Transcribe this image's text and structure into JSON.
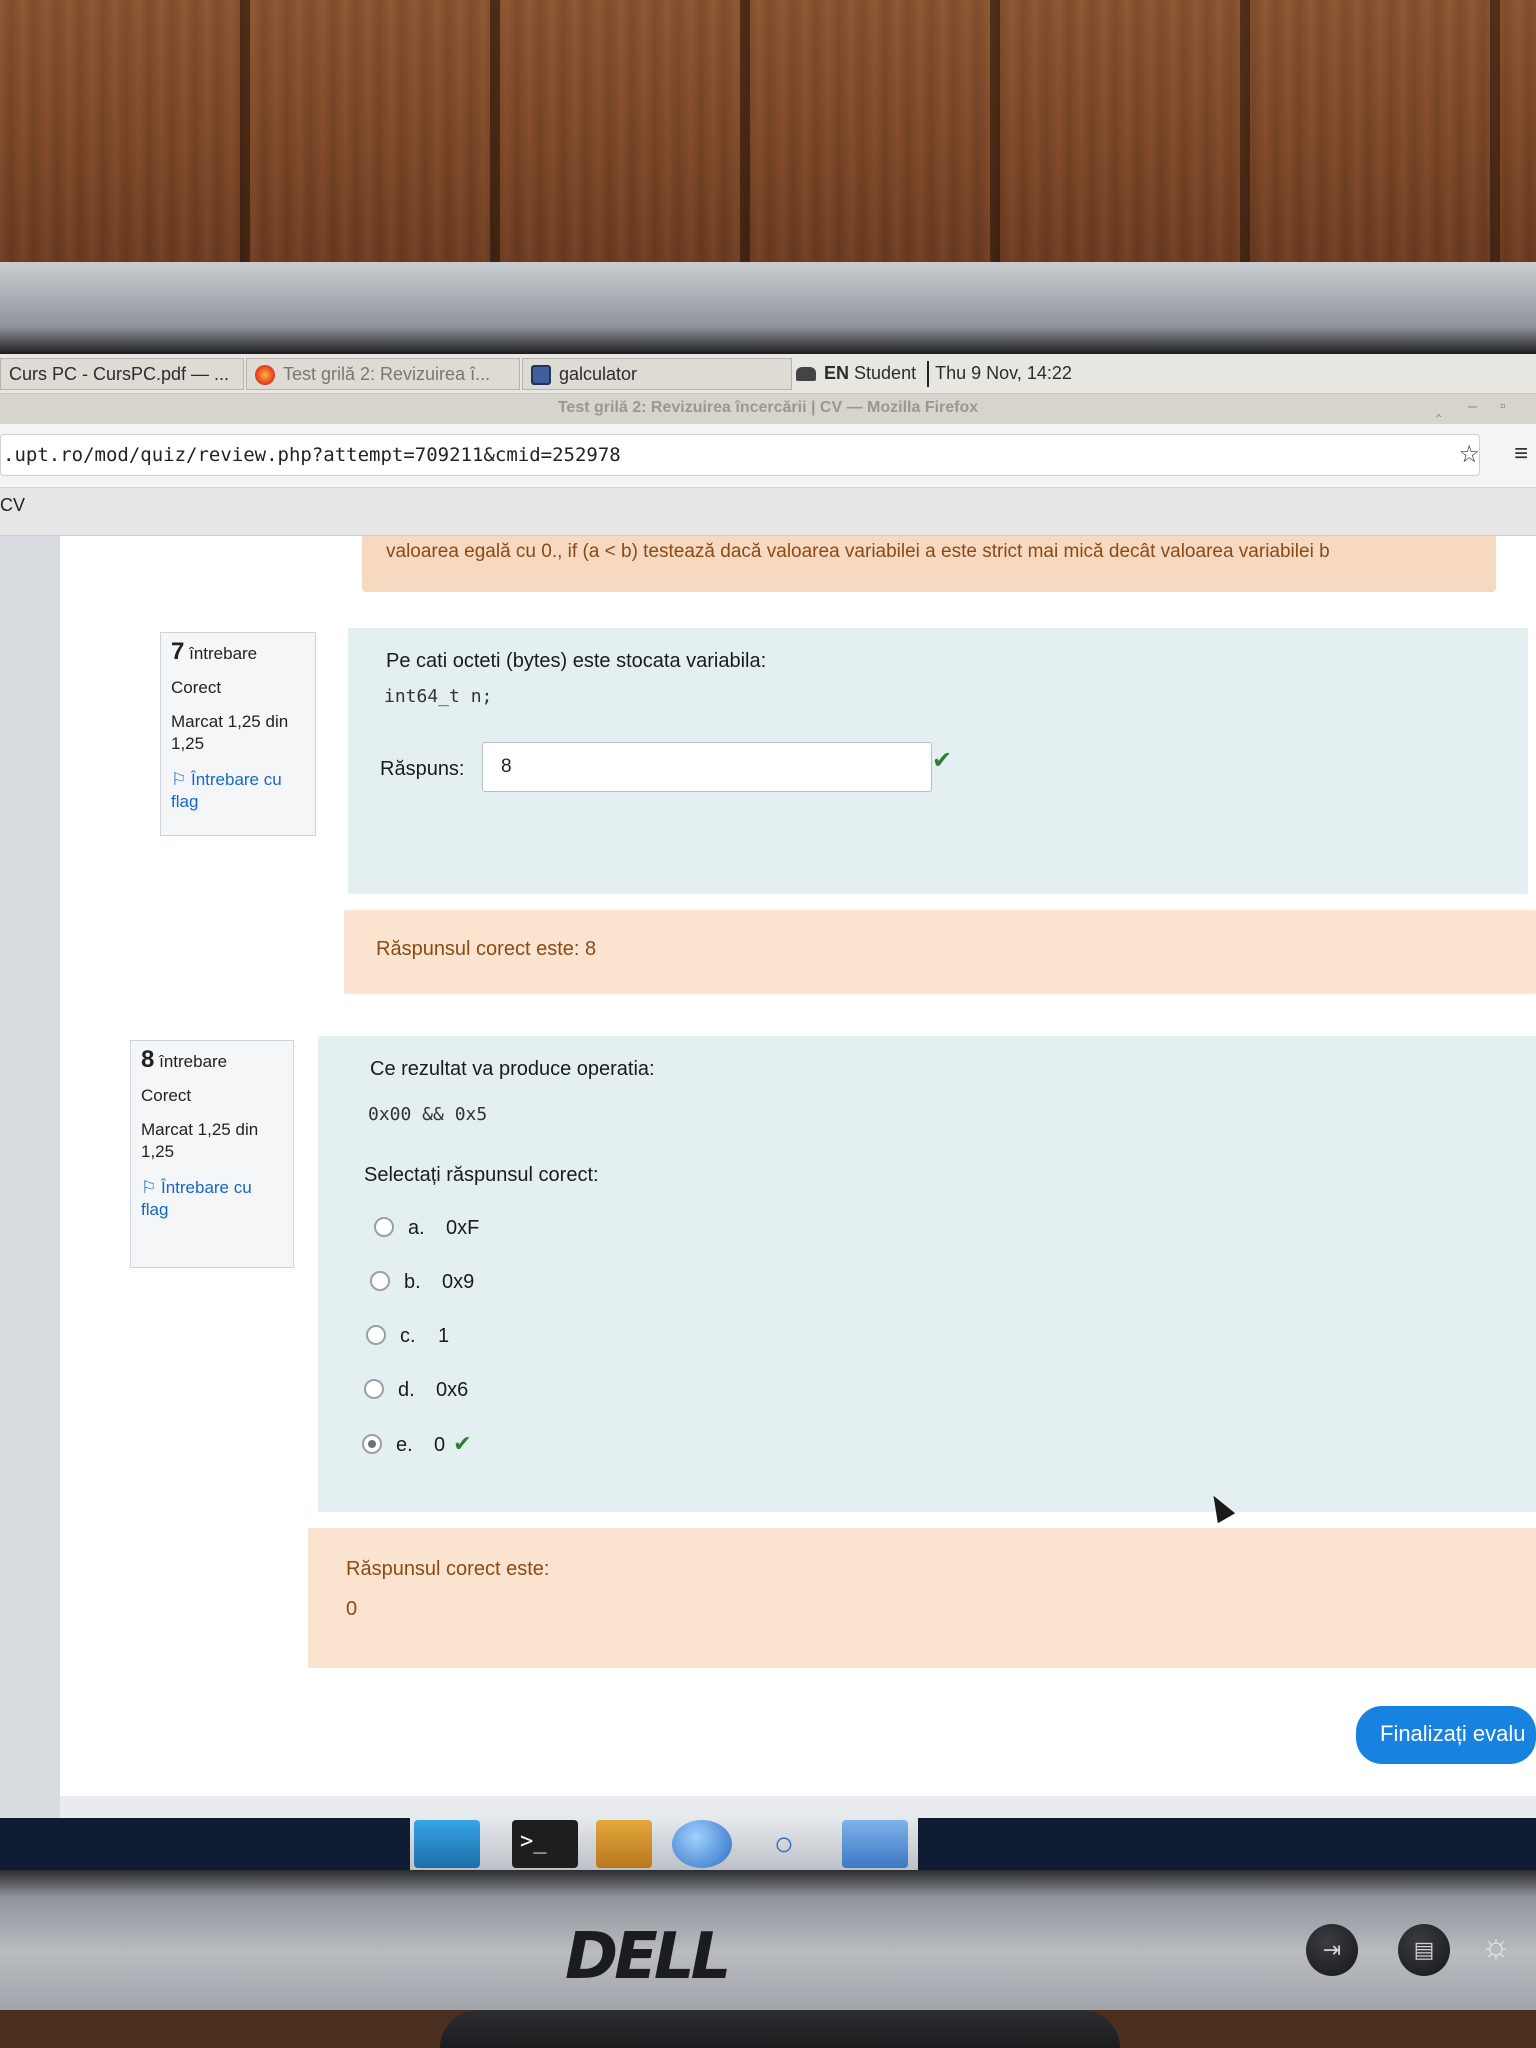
{
  "taskbar": {
    "items": [
      {
        "label": "Curs PC - CursPC.pdf — ...",
        "icon": "document-icon"
      },
      {
        "label": "Test grilă 2: Revizuirea î...",
        "icon": "firefox-icon"
      },
      {
        "label": "galculator",
        "icon": "calculator-icon"
      }
    ],
    "keyboard": "EN",
    "user": "Student",
    "datetime": "Thu  9 Nov, 14:22"
  },
  "window": {
    "title": "Test grilă 2: Revizuirea încercării | CV — Mozilla Firefox"
  },
  "browser": {
    "url": ".upt.ro/mod/quiz/review.php?attempt=709211&cmid=252978",
    "tab_label": "CV"
  },
  "previous_feedback": "valoarea egală cu 0., if (a < b) testează dacă valoarea variabilei a este strict mai mică decât valoarea variabilei b",
  "questions": [
    {
      "number": "7",
      "word": "întrebare",
      "status": "Corect",
      "mark": "Marcat 1,25 din 1,25",
      "flag_label": "Întrebare cu flag",
      "text": "Pe cati octeti (bytes) este stocata variabila:",
      "code": "int64_t n;",
      "answer_label": "Răspuns:",
      "answer_value": "8",
      "correct_answer": "Răspunsul corect este: 8"
    },
    {
      "number": "8",
      "word": "întrebare",
      "status": "Corect",
      "mark": "Marcat 1,25 din 1,25",
      "flag_label": "Întrebare cu flag",
      "text": "Ce rezultat va produce operatia:",
      "code": "0x00 && 0x5",
      "prompt": "Selectați răspunsul corect:",
      "options": [
        {
          "letter": "a.",
          "value": "0xF",
          "selected": false
        },
        {
          "letter": "b.",
          "value": "0x9",
          "selected": false
        },
        {
          "letter": "c.",
          "value": "1",
          "selected": false
        },
        {
          "letter": "d.",
          "value": "0x6",
          "selected": false
        },
        {
          "letter": "e.",
          "value": "0",
          "selected": true
        }
      ],
      "correct_answer_label": "Răspunsul corect este:",
      "correct_answer_value": "0"
    }
  ],
  "submit_button": "Finalizați evalu",
  "monitor_brand": "DELL",
  "colors": {
    "formulation_bg": "#e4eff1",
    "outcome_bg": "#fbe4cf",
    "link": "#1567c9",
    "primary_button": "#1782e0",
    "correct_check": "#2e7d32"
  }
}
